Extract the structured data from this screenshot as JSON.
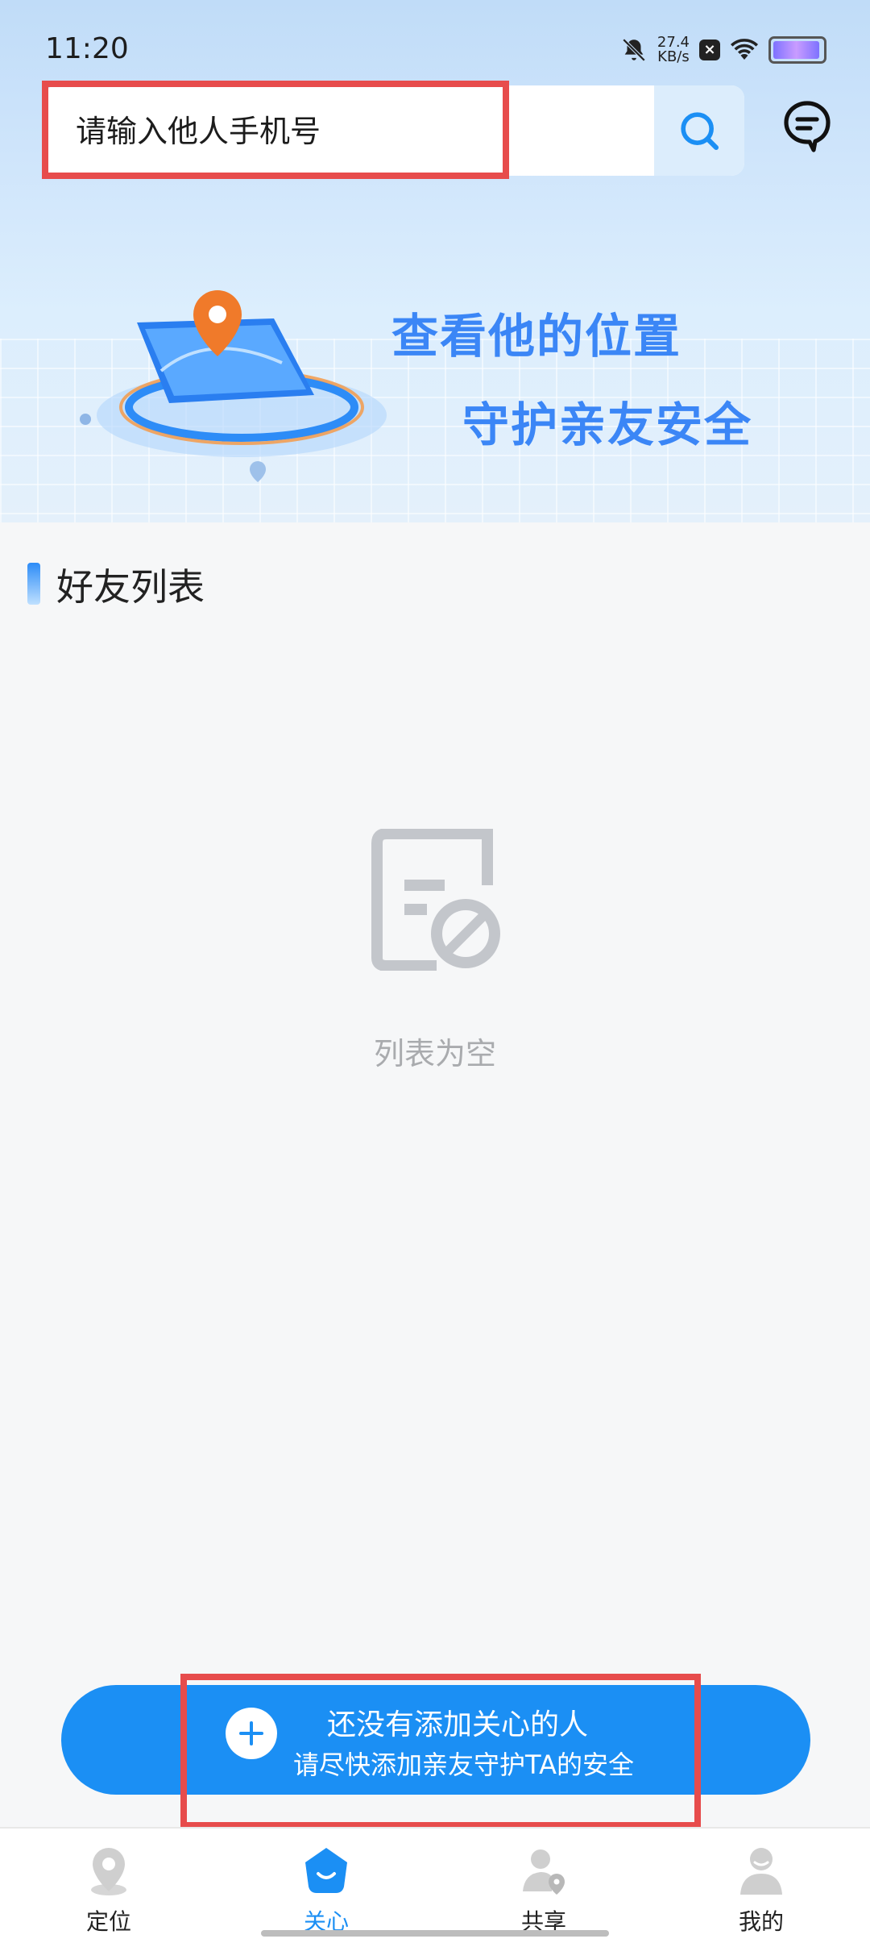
{
  "status_bar": {
    "time": "11:20",
    "net_speed_value": "27.4",
    "net_speed_unit": "KB/s"
  },
  "search": {
    "placeholder": "请输入他人手机号"
  },
  "banner": {
    "line1": "查看他的位置",
    "line2": "守护亲友安全"
  },
  "friends": {
    "title": "好友列表",
    "empty_text": "列表为空"
  },
  "add_button": {
    "line1": "还没有添加关心的人",
    "line2": "请尽快添加亲友守护TA的安全"
  },
  "nav": {
    "items": [
      {
        "label": "定位",
        "icon": "location-pin-icon"
      },
      {
        "label": "关心",
        "icon": "heart-home-icon",
        "active": true
      },
      {
        "label": "共享",
        "icon": "share-person-icon"
      },
      {
        "label": "我的",
        "icon": "profile-icon"
      }
    ]
  },
  "colors": {
    "accent": "#1b8ff4",
    "highlight": "#e74c4c",
    "banner_text": "#3b86f6"
  }
}
